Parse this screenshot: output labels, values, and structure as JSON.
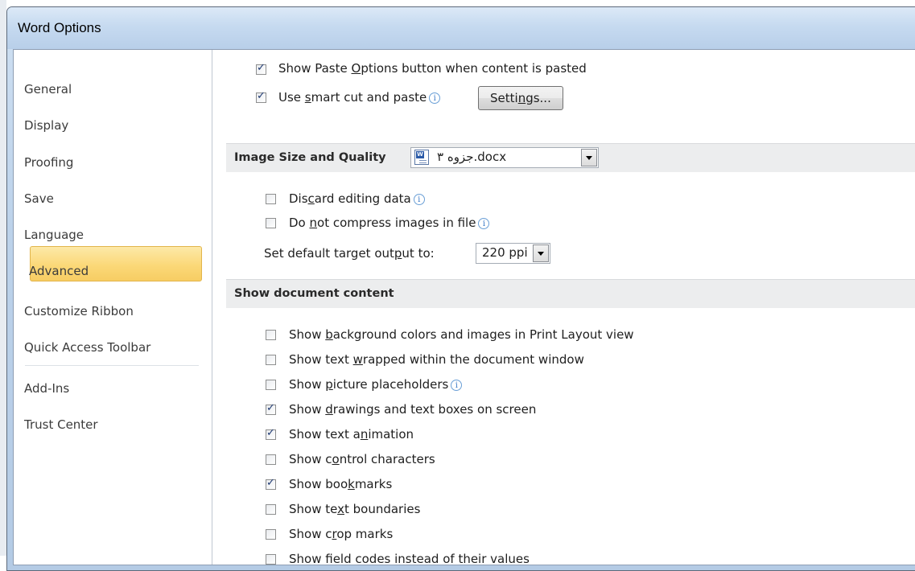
{
  "window": {
    "title": "Word Options"
  },
  "sidebar": {
    "items": [
      {
        "label": "General"
      },
      {
        "label": "Display"
      },
      {
        "label": "Proofing"
      },
      {
        "label": "Save"
      },
      {
        "label": "Language"
      },
      {
        "label": "Advanced",
        "selected": true
      },
      {
        "label": "Customize Ribbon"
      },
      {
        "label": "Quick Access Toolbar"
      },
      {
        "label": "Add-Ins"
      },
      {
        "label": "Trust Center"
      }
    ]
  },
  "cut_paste": {
    "show_paste_options": {
      "pre": "Show Paste ",
      "ul": "O",
      "post": "ptions button when content is pasted",
      "checked": true
    },
    "smart_cut": {
      "pre": "Use ",
      "ul": "s",
      "post": "mart cut and paste",
      "checked": true
    },
    "settings_button": {
      "pre": "Setti",
      "ul": "n",
      "post": "gs..."
    }
  },
  "image_size": {
    "header": "Image Size and Quality",
    "document": "جزوه ۳.docx",
    "discard_editing": {
      "pre": "Dis",
      "ul": "c",
      "post": "ard editing data",
      "checked": false
    },
    "no_compress": {
      "pre": "Do ",
      "ul": "n",
      "post": "ot compress images in file",
      "checked": false
    },
    "target_output": {
      "pre": "Set default target out",
      "ul": "p",
      "post": "ut to:"
    },
    "ppi_value": "220 ppi"
  },
  "show_content": {
    "header": "Show document content",
    "options": [
      {
        "pre": "Show ",
        "ul": "b",
        "post": "ackground colors and images in Print Layout view",
        "checked": false,
        "info": false
      },
      {
        "pre": "Show text ",
        "ul": "w",
        "post": "rapped within the document window",
        "checked": false,
        "info": false
      },
      {
        "pre": "Show ",
        "ul": "p",
        "post": "icture placeholders",
        "checked": false,
        "info": true
      },
      {
        "pre": "Show ",
        "ul": "d",
        "post": "rawings and text boxes on screen",
        "checked": true,
        "info": false
      },
      {
        "pre": "Show text a",
        "ul": "n",
        "post": "imation",
        "checked": true,
        "info": false
      },
      {
        "pre": "Show c",
        "ul": "o",
        "post": "ntrol characters",
        "checked": false,
        "info": false
      },
      {
        "pre": "Show boo",
        "ul": "k",
        "post": "marks",
        "checked": true,
        "info": false
      },
      {
        "pre": "Show te",
        "ul": "x",
        "post": "t boundaries",
        "checked": false,
        "info": false
      },
      {
        "pre": "Show c",
        "ul": "r",
        "post": "op marks",
        "checked": false,
        "info": false
      },
      {
        "pre": "Show field codes instead of their values",
        "ul": "",
        "post": "",
        "checked": false,
        "info": false
      }
    ]
  },
  "icons": {
    "info": "i",
    "document": "word-document-icon",
    "dropdown": "chevron-down-icon"
  },
  "colors": {
    "selected_nav_bg": "#fbd878",
    "section_bg": "#ecedee",
    "title_bar": "#c6daf0"
  }
}
